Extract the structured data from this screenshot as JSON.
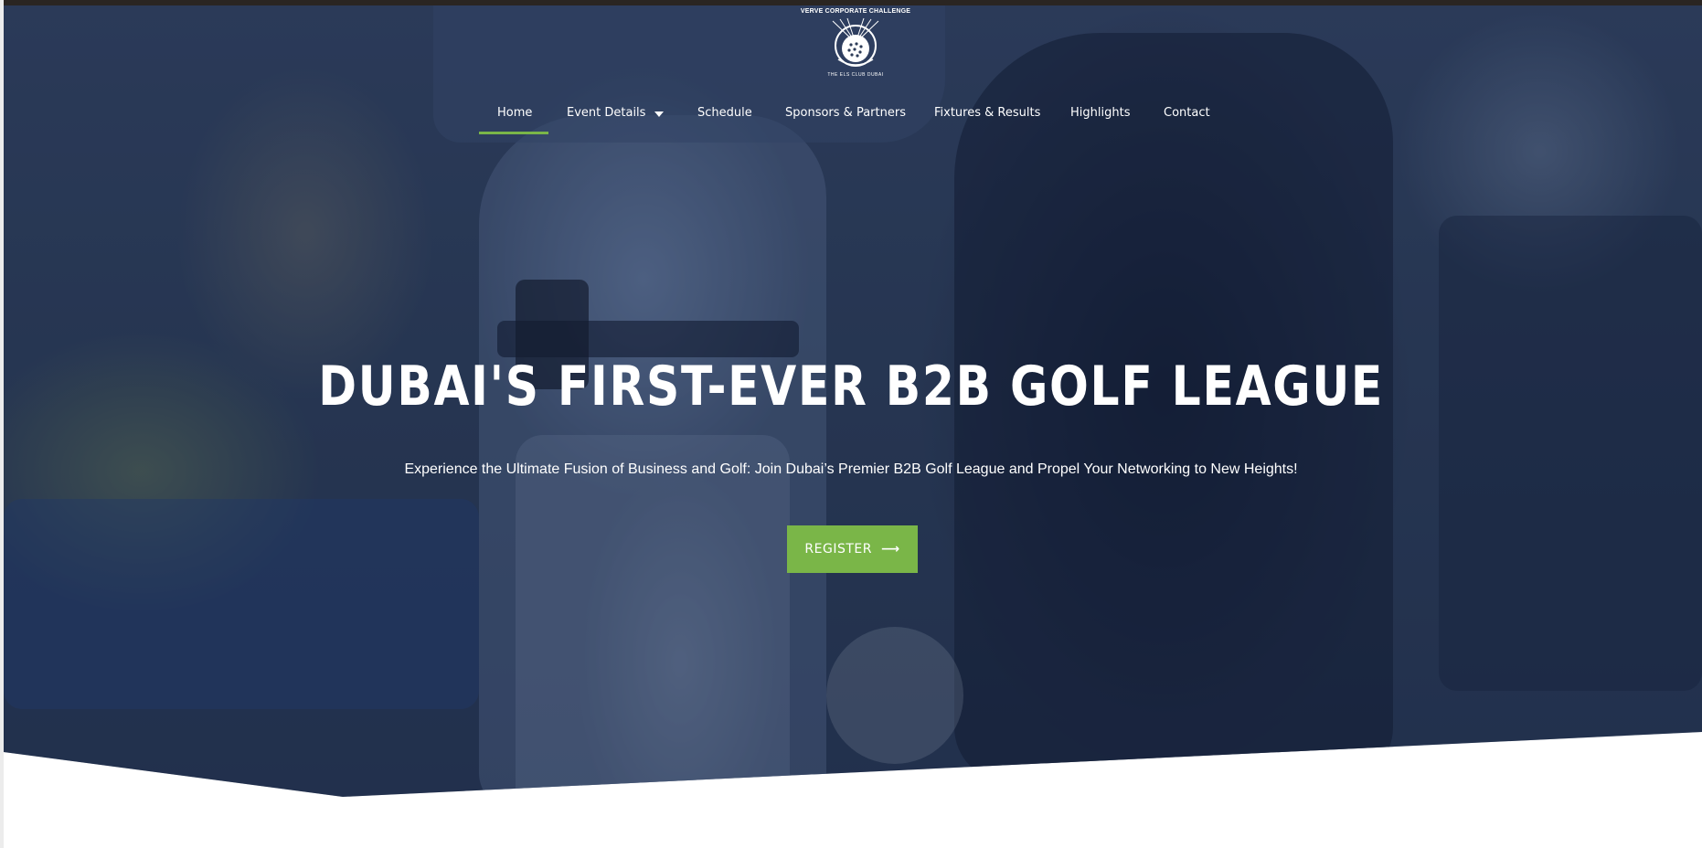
{
  "brand": {
    "logo_top_text": "VERVE CORPORATE CHALLENGE",
    "logo_bottom_text": "THE ELS CLUB DUBAI",
    "accent_color": "#7ab648"
  },
  "nav": {
    "items": [
      {
        "label": "Home",
        "active": true
      },
      {
        "label": "Event Details",
        "has_dropdown": true,
        "icon": "chevron-down-icon"
      },
      {
        "label": "Schedule"
      },
      {
        "label": "Sponsors & Partners"
      },
      {
        "label": "Fixtures & Results"
      },
      {
        "label": "Highlights"
      },
      {
        "label": "Contact"
      }
    ]
  },
  "hero": {
    "headline": "DUBAI'S FIRST-EVER B2B GOLF LEAGUE",
    "subtext": "Experience the Ultimate Fusion of Business and Golf: Join Dubai’s Premier B2B Golf League and Propel Your Networking to New Heights!",
    "cta_label": "REGISTER",
    "cta_icon": "arrow-right-icon"
  }
}
